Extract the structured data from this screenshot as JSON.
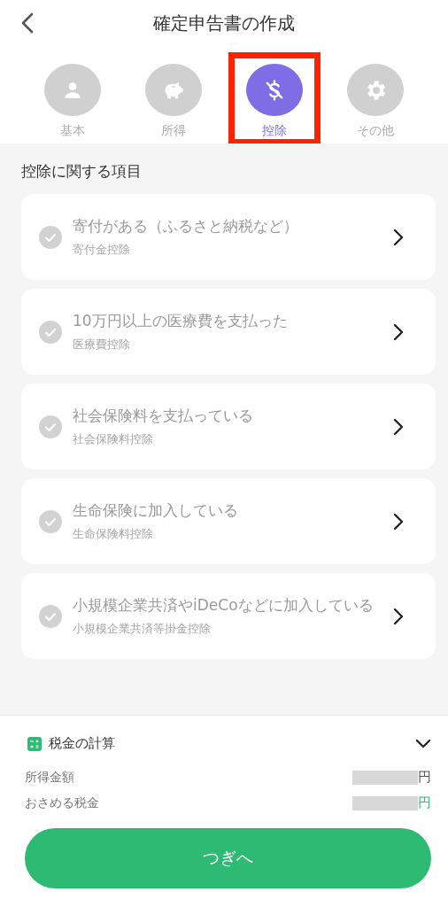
{
  "header": {
    "title": "確定申告書の作成"
  },
  "tabs": [
    {
      "label": "基本",
      "selected": false,
      "highlighted": false
    },
    {
      "label": "所得",
      "selected": false,
      "highlighted": false
    },
    {
      "label": "控除",
      "selected": true,
      "highlighted": true
    },
    {
      "label": "その他",
      "selected": false,
      "highlighted": false
    }
  ],
  "section": {
    "title": "控除に関する項目"
  },
  "items": [
    {
      "title": "寄付がある（ふるさと納税など）",
      "subtitle": "寄付金控除",
      "checked": false
    },
    {
      "title": "10万円以上の医療費を支払った",
      "subtitle": "医療費控除",
      "checked": false
    },
    {
      "title": "社会保険料を支払っている",
      "subtitle": "社会保険料控除",
      "checked": false
    },
    {
      "title": "生命保険に加入している",
      "subtitle": "生命保険料控除",
      "checked": false
    },
    {
      "title": "小規模企業共済やiDeCoなどに加入している",
      "subtitle": "小規模企業共済等掛金控除",
      "checked": false
    }
  ],
  "tax_panel": {
    "title": "税金の計算",
    "expanded": false,
    "rows": [
      {
        "label": "所得金額",
        "unit": "円",
        "redacted": true,
        "emphasis": false
      },
      {
        "label": "おさめる税金",
        "unit": "円",
        "redacted": true,
        "emphasis": true
      }
    ]
  },
  "next_button": {
    "label": "つぎへ"
  }
}
